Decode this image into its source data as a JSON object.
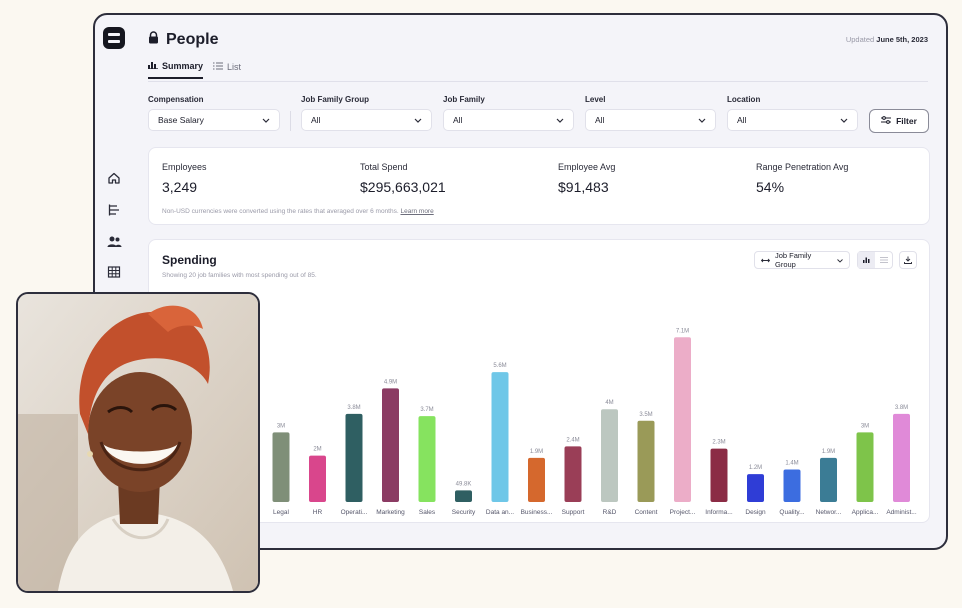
{
  "page": {
    "title": "People",
    "updated_prefix": "Updated",
    "updated_date": "June 5th, 2023"
  },
  "tabs": [
    {
      "label": "Summary",
      "active": true,
      "icon": "bar-chart-icon"
    },
    {
      "label": "List",
      "active": false,
      "icon": "list-icon"
    }
  ],
  "filters": [
    {
      "label": "Compensation",
      "value": "Base Salary"
    },
    {
      "label": "Job Family Group",
      "value": "All"
    },
    {
      "label": "Job Family",
      "value": "All"
    },
    {
      "label": "Level",
      "value": "All"
    },
    {
      "label": "Location",
      "value": "All"
    }
  ],
  "filter_button": "Filter",
  "stats": [
    {
      "label": "Employees",
      "value": "3,249"
    },
    {
      "label": "Total Spend",
      "value": "$295,663,021"
    },
    {
      "label": "Employee Avg",
      "value": "$91,483"
    },
    {
      "label": "Range Penetration Avg",
      "value": "54%"
    }
  ],
  "stats_note": "Non-USD currencies were converted using the rates that averaged over 6 months.",
  "stats_note_link": "Learn more",
  "spending": {
    "title": "Spending",
    "subtitle": "Showing 20 job families with most spending out of 85.",
    "group_by": "Job Family Group"
  },
  "nav_icons": [
    "home-icon",
    "org-chart-icon",
    "people-icon",
    "grid-icon"
  ],
  "chart_data": {
    "type": "bar",
    "categories": [
      "Legal",
      "HR",
      "Operati...",
      "Marketing",
      "Sales",
      "Security",
      "Data an...",
      "Business...",
      "Support",
      "R&D",
      "Content",
      "Project...",
      "Informa...",
      "Design",
      "Quality...",
      "Networ...",
      "Applica...",
      "Administ..."
    ],
    "values": [
      3.0,
      2.0,
      3.8,
      4.9,
      3.7,
      0.4985,
      5.6,
      1.9,
      2.4,
      4.0,
      3.5,
      7.1,
      2.3,
      1.2,
      1.4,
      1.9,
      3.0,
      3.8
    ],
    "value_labels": [
      "3M",
      "2M",
      "3.8M",
      "4.9M",
      "3.7M",
      "49.8K",
      "5.6M",
      "1.9M",
      "2.4M",
      "4M",
      "3.5M",
      "7.1M",
      "2.3M",
      "1.2M",
      "1.4M",
      "1.9M",
      "3M",
      "3.8M"
    ],
    "colors": [
      "#7f8f78",
      "#d9468c",
      "#2f5f62",
      "#8b3b63",
      "#86e35f",
      "#2f5f62",
      "#6fc7e8",
      "#d5682d",
      "#9a3e57",
      "#bcc7c0",
      "#9a9a58",
      "#ecadc8",
      "#8b2c45",
      "#2f3dd6",
      "#3c6de0",
      "#3b7c95",
      "#7ec44a",
      "#e08ad8"
    ],
    "ylim": [
      0,
      7.5
    ],
    "title": "Spending",
    "xlabel": "",
    "ylabel": ""
  }
}
